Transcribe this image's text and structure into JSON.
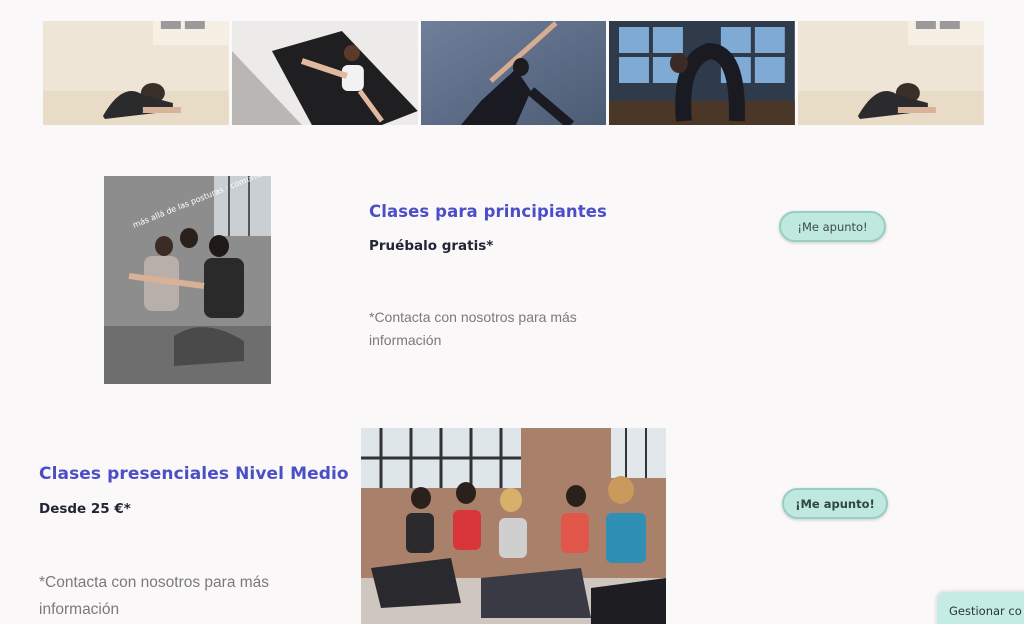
{
  "gallery": {
    "images": [
      {
        "alt": "yoga-seated-forward-fold"
      },
      {
        "alt": "yoga-mat-stretch"
      },
      {
        "alt": "yoga-lunge-reach"
      },
      {
        "alt": "yoga-backbend-window"
      },
      {
        "alt": "yoga-seated-forward-fold"
      }
    ]
  },
  "section_beginners": {
    "image_caption": "más allá de las posturas · comunidad",
    "title": "Clases para principiantes",
    "subtitle": "Pruébalo gratis*",
    "note": "*Contacta con nosotros para más información",
    "button_label": "¡Me apunto!"
  },
  "section_intermediate": {
    "title": "Clases presenciales Nivel Medio",
    "subtitle": "Desde 25 €*",
    "note": "*Contacta con nosotros para más información",
    "button_label": "¡Me apunto!"
  },
  "cookie_bar": {
    "label": "Gestionar co"
  },
  "colors": {
    "accent_title": "#4b4fc7",
    "button_bg": "#bfe8df",
    "page_bg": "#fbf8f9"
  }
}
